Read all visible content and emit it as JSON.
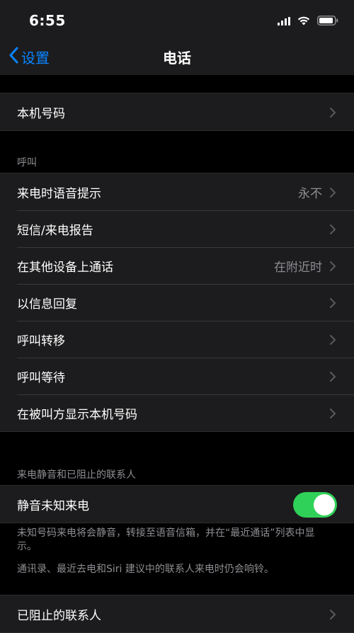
{
  "status_bar": {
    "time": "6:55"
  },
  "nav": {
    "back_label": "设置",
    "title": "电话"
  },
  "groups": {
    "my_number": {
      "label": "本机号码"
    },
    "calls": {
      "header": "呼叫",
      "items": [
        {
          "label": "来电时语音提示",
          "value": "永不"
        },
        {
          "label": "短信/来电报告",
          "value": ""
        },
        {
          "label": "在其他设备上通话",
          "value": "在附近时"
        },
        {
          "label": "以信息回复",
          "value": ""
        },
        {
          "label": "呼叫转移",
          "value": ""
        },
        {
          "label": "呼叫等待",
          "value": ""
        },
        {
          "label": "在被叫方显示本机号码",
          "value": ""
        }
      ]
    },
    "silence": {
      "header": "来电静音和已阻止的联系人",
      "toggle_label": "静音未知来电",
      "toggle_on": true,
      "footer_1": "未知号码来电将会静音，转接至语音信箱，并在“最近通话”列表中显示。",
      "footer_2": "通讯录、最近去电和Siri 建议中的联系人来电时仍会响铃。",
      "blocked_label": "已阻止的联系人"
    }
  },
  "colors": {
    "accent": "#0a84ff",
    "toggle_on": "#30d158",
    "background": "#000000",
    "cell": "#1c1c1e",
    "secondary_text": "#8e8e93"
  }
}
